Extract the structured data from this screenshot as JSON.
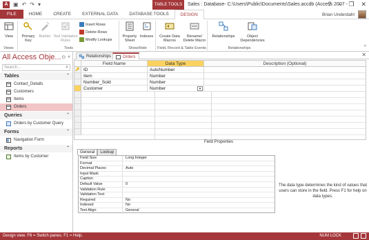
{
  "titlebar": {
    "app_icon": "A",
    "contextual_group": "TABLE TOOLS",
    "title": "Sales : Database- C:\\Users\\Public\\Documents\\Sales.accdb (Access 2007 -",
    "controls": [
      "?",
      "–",
      "❐",
      "✕"
    ],
    "qat_icons": [
      "save-icon",
      "undo-icon",
      "redo-icon"
    ]
  },
  "ribbon_tabs": [
    "FILE",
    "HOME",
    "CREATE",
    "EXTERNAL DATA",
    "DATABASE TOOLS",
    "DESIGN"
  ],
  "user": {
    "name": "Brian Underdahl"
  },
  "ribbon": {
    "views": {
      "label": "Views",
      "view_btn": "View"
    },
    "tools": {
      "label": "Tools",
      "primary_key": "Primary Key",
      "builder": "Builder",
      "test_validation": "Test Validation Rules",
      "insert_rows": "Insert Rows",
      "delete_rows": "Delete Rows",
      "modify_lookups": "Modify Lookups"
    },
    "show_hide": {
      "label": "Show/Hide",
      "property_sheet": "Property Sheet",
      "indexes": "Indexes"
    },
    "field_events": {
      "label": "Field, Record & Table Events",
      "create_data_macros": "Create Data Macros",
      "rename_delete_macro": "Rename/ Delete Macro"
    },
    "relationships": {
      "label": "Relationships",
      "relationships_btn": "Relationships",
      "object_dependencies": "Object Dependencies"
    }
  },
  "navpane": {
    "title": "All Access Obje...",
    "search_placeholder": "Search...",
    "sections": [
      {
        "name": "Tables",
        "items": [
          "Contact_Details",
          "Customers",
          "Items",
          "Orders"
        ]
      },
      {
        "name": "Queries",
        "items": [
          "Orders by Customer Query"
        ]
      },
      {
        "name": "Forms",
        "items": [
          "Navigation Form"
        ]
      },
      {
        "name": "Reports",
        "items": [
          "Items by Customer"
        ]
      }
    ],
    "selected": "Orders"
  },
  "doc_tabs": [
    "Relationships",
    "Orders"
  ],
  "design_grid": {
    "headers": [
      "Field Name",
      "Data Type",
      "Description (Optional)"
    ],
    "rows": [
      {
        "field": "ID",
        "type": "AutoNumber",
        "desc": ""
      },
      {
        "field": "Item",
        "type": "Number",
        "desc": ""
      },
      {
        "field": "Number_Sold",
        "type": "Number",
        "desc": ""
      },
      {
        "field": "Customer",
        "type": "Number",
        "desc": ""
      }
    ]
  },
  "field_properties": {
    "title": "Field Properties",
    "tabs": [
      "General",
      "Lookup"
    ],
    "rows": [
      [
        "Field Size",
        "Long Integer"
      ],
      [
        "Format",
        ""
      ],
      [
        "Decimal Places",
        "Auto"
      ],
      [
        "Input Mask",
        ""
      ],
      [
        "Caption",
        ""
      ],
      [
        "Default Value",
        "0"
      ],
      [
        "Validation Rule",
        ""
      ],
      [
        "Validation Text",
        ""
      ],
      [
        "Required",
        "No"
      ],
      [
        "Indexed",
        "No"
      ],
      [
        "Text Align",
        "General"
      ]
    ],
    "help": "The data type determines the kind of values that users can store in the field. Press F1 for help on data types."
  },
  "status": {
    "left": "Design view.  F6 = Switch panes.  F1 = Help.",
    "right": "NUM LOCK"
  },
  "colors": {
    "accent": "#a4373a",
    "active_header": "#fbd25f",
    "selected_nav": "#f2c5c6"
  }
}
